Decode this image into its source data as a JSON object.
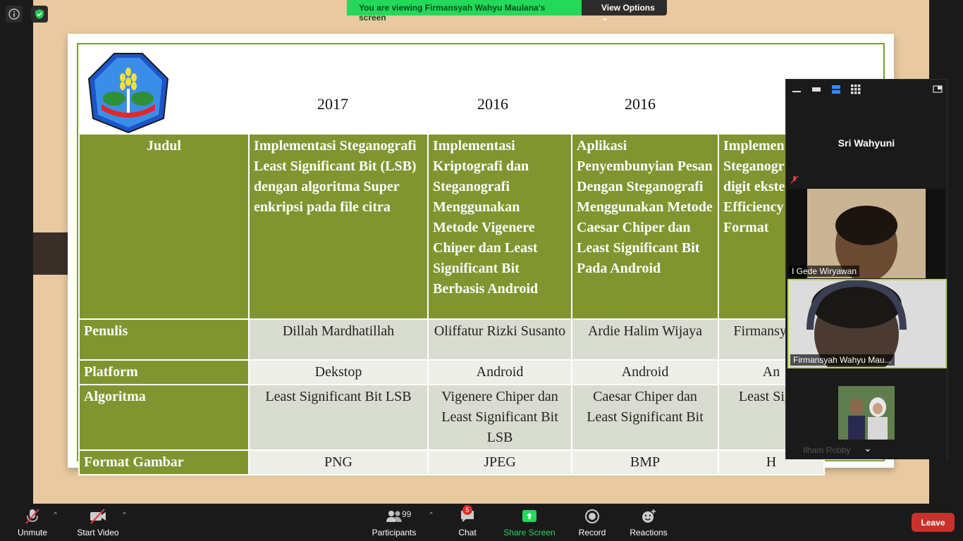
{
  "banner": {
    "viewing": "You are viewing Firmansyah Wahyu Maulana's screen",
    "view_options": "View Options"
  },
  "slide": {
    "years": [
      "2017",
      "2016",
      "2016"
    ],
    "row_labels": {
      "judul": "Judul",
      "penulis": "Penulis",
      "platform": "Platform",
      "algoritma": "Algoritma",
      "format": "Format Gambar"
    },
    "columns": [
      {
        "judul": "Implementasi Steganografi Least Significant Bit (LSB) dengan algoritma Super enkripsi pada file citra",
        "penulis": "Dillah Mardhatillah",
        "platform": "Dekstop",
        "algoritma": "Least Significant Bit  LSB",
        "format": "PNG"
      },
      {
        "judul": "Implementasi Kriptografi dan Steganografi Menggunakan Metode Vigenere Chiper dan Least Significant Bit Berbasis Android",
        "penulis": "Oliffatur Rizki Susanto",
        "platform": "Android",
        "algoritma": "Vigenere Chiper dan Least Significant Bit LSB",
        "format": "JPEG"
      },
      {
        "judul": "Aplikasi Penyembunyian Pesan Dengan Steganografi Menggunakan Metode Caesar Chiper dan Least Significant Bit Pada Android",
        "penulis": "Ardie Halim Wijaya",
        "platform": "Android",
        "algoritma": "Caesar Chiper dan Least Significant Bit",
        "format": "BMP"
      },
      {
        "judul": "Implemen Steganogr citra digit ekstensi H Efficiency Format",
        "penulis": "Firmansy Ma",
        "platform": "An",
        "algoritma": "Least Sig L",
        "format": "H"
      }
    ]
  },
  "video_panel": {
    "active_speaker": "Sri Wahyuni",
    "tiles": [
      {
        "name": "I Gede Wiryawan"
      },
      {
        "name": "Firmansyah Wahyu Mau..."
      },
      {
        "name": "Ilham Robby"
      }
    ]
  },
  "toolbar": {
    "unmute": "Unmute",
    "start_video": "Start Video",
    "participants": "Participants",
    "participants_count": "99",
    "chat": "Chat",
    "chat_badge": "5",
    "share_screen": "Share Screen",
    "record": "Record",
    "reactions": "Reactions",
    "leave": "Leave"
  },
  "colors": {
    "slide_green": "#809530",
    "share_green": "#23d959",
    "leave_red": "#c8322c"
  }
}
